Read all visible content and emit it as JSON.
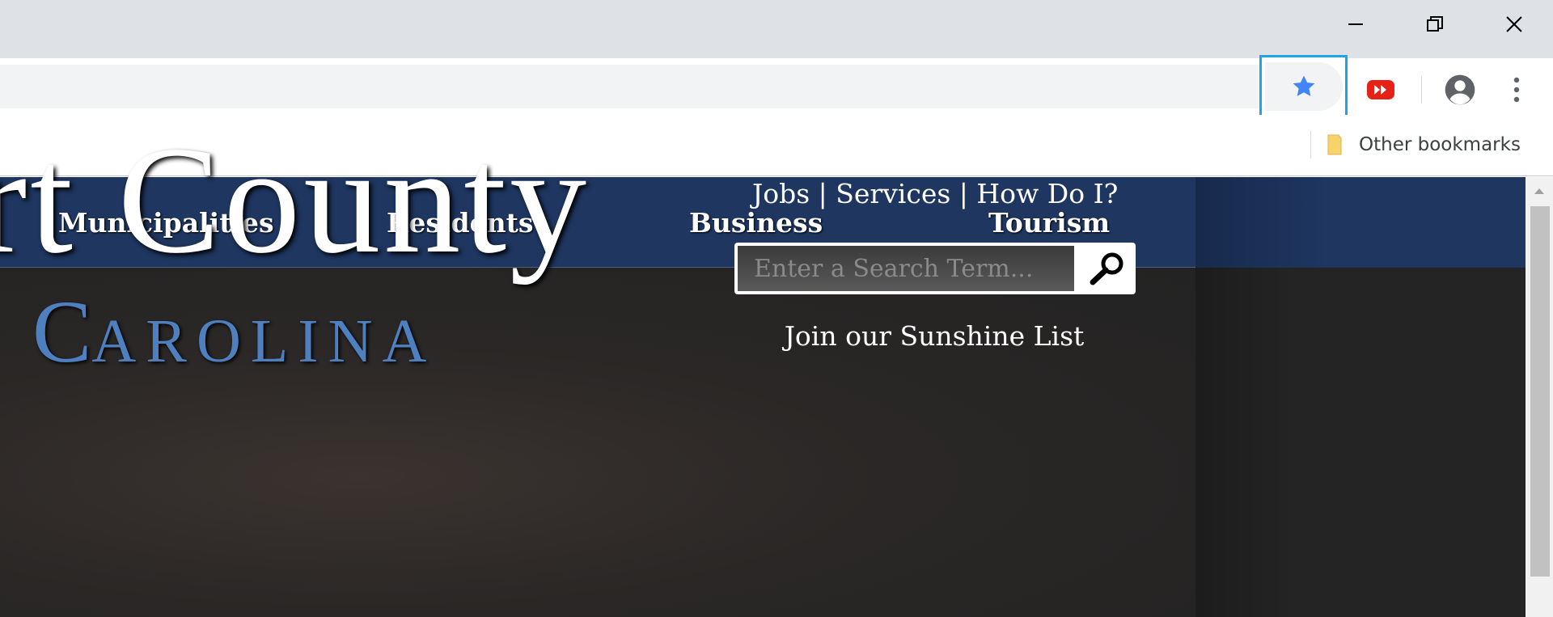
{
  "browser": {
    "window_controls": {
      "minimize": "minimize-icon",
      "restore": "restore-icon",
      "close": "close-icon"
    },
    "toolbar": {
      "bookmark_star": {
        "icon": "star-icon",
        "color": "#4285f4",
        "highlight_color": "#1aa6e8"
      },
      "extension": {
        "icon": "youtube-extension-icon",
        "color": "#e62117"
      },
      "profile": {
        "icon": "account-circle-icon"
      },
      "menu": {
        "icon": "kebab-menu-icon"
      }
    },
    "bookmarks_bar": {
      "other_bookmarks": {
        "label": "Other bookmarks",
        "icon": "folder-icon",
        "color": "#f6d36b"
      }
    }
  },
  "page": {
    "nav": {
      "items": [
        {
          "label": "Municipalities"
        },
        {
          "label": "Residents"
        },
        {
          "label": "Business"
        },
        {
          "label": "Tourism"
        }
      ],
      "background": "#1e3660"
    },
    "hero": {
      "county_title": "rt County",
      "state_title_initial": "C",
      "state_title_rest": "AROLINA",
      "state_color": "#4e7fbf",
      "quick_links": "Jobs | Services | How Do I?",
      "search": {
        "placeholder": "Enter a Search Term...",
        "value": "",
        "icon": "search-icon"
      },
      "sunshine_link": "Join our Sunshine List"
    }
  },
  "scrollbar": {
    "up_icon": "arrow-up-icon"
  }
}
